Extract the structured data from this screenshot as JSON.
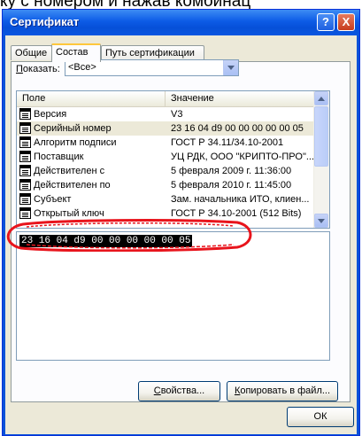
{
  "caption": "ку с номером и нажав комбинац",
  "window": {
    "title": "Сертификат",
    "help_label": "?",
    "close_label": "X"
  },
  "tabs": [
    {
      "label": "Общие"
    },
    {
      "label": "Состав"
    },
    {
      "label": "Путь сертификации"
    }
  ],
  "show": {
    "label_pre": "",
    "label_underlined": "П",
    "label_post": "оказать:",
    "selected": "<Все>"
  },
  "table": {
    "col_field": "Поле",
    "col_value": "Значение",
    "rows": [
      {
        "field": "Версия",
        "value": "V3"
      },
      {
        "field": "Серийный номер",
        "value": "23 16 04 d9 00 00 00 00 00 05"
      },
      {
        "field": "Алгоритм подписи",
        "value": "ГОСТ Р 34.11/34.10-2001"
      },
      {
        "field": "Поставщик",
        "value": "УЦ РДК, ООО \"КРИПТО-ПРО\"..."
      },
      {
        "field": "Действителен с",
        "value": "5 февраля 2009 г. 11:36:00"
      },
      {
        "field": "Действителен по",
        "value": "5 февраля 2010 г. 11:45:00"
      },
      {
        "field": "Субъект",
        "value": "Зам. начальника ИТО, клиен..."
      },
      {
        "field": "Открытый ключ",
        "value": "ГОСТ Р 34.10-2001 (512 Bits)"
      }
    ]
  },
  "detail_text": "23 16 04 d9 00 00 00 00 00 05",
  "buttons": {
    "props_u": "С",
    "props_rest": "войства...",
    "copy_u": "К",
    "copy_rest": "опировать в файл...",
    "ok": "ОК"
  },
  "colors": {
    "title_bar": "#0a56e0",
    "highlight_ellipse": "#e8141c",
    "tab_active_accent": "#ffc73c"
  }
}
